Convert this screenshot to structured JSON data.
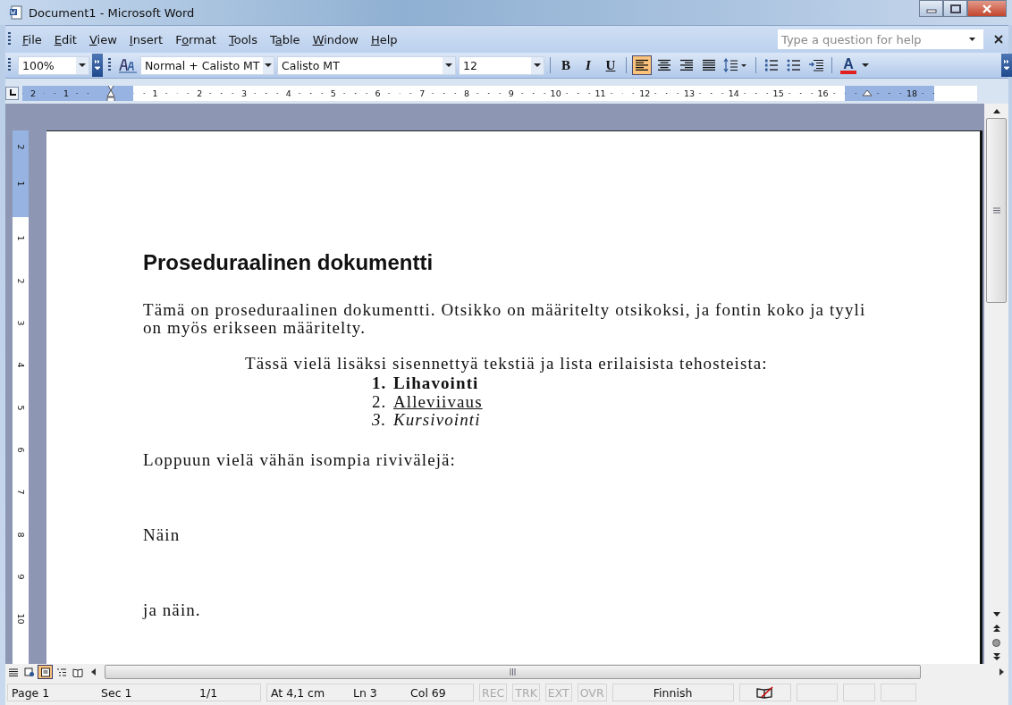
{
  "window": {
    "title": "Document1 - Microsoft Word"
  },
  "menu": [
    {
      "label": "File"
    },
    {
      "label": "Edit"
    },
    {
      "label": "View"
    },
    {
      "label": "Insert"
    },
    {
      "label": "Format"
    },
    {
      "label": "Tools"
    },
    {
      "label": "Table"
    },
    {
      "label": "Window"
    },
    {
      "label": "Help"
    }
  ],
  "help_box": {
    "placeholder": "Type a question for help"
  },
  "toolbar": [
    {
      "kind": "zoom",
      "value": "100%"
    },
    {
      "kind": "style",
      "value": "Normal + Calisto MT"
    },
    {
      "kind": "font",
      "value": "Calisto MT"
    },
    {
      "kind": "size",
      "value": "12"
    },
    {
      "kind": "bold",
      "label": "B",
      "selected": false
    },
    {
      "kind": "italic",
      "label": "I",
      "selected": false
    },
    {
      "kind": "underline",
      "label": "U",
      "selected": false
    },
    {
      "kind": "align-left",
      "selected": true
    },
    {
      "kind": "align-center",
      "selected": false
    },
    {
      "kind": "align-right",
      "selected": false
    },
    {
      "kind": "justify",
      "selected": false
    },
    {
      "kind": "line-spacing"
    },
    {
      "kind": "numbering"
    },
    {
      "kind": "bullets"
    },
    {
      "kind": "indent"
    },
    {
      "kind": "font-color",
      "label": "A"
    }
  ],
  "ruler": {
    "horizontal_before": [
      "2",
      "1"
    ],
    "horizontal_after": [
      "1",
      "2",
      "3",
      "4",
      "5",
      "6",
      "7",
      "8",
      "9",
      "10",
      "11",
      "12",
      "13",
      "14",
      "15",
      "16"
    ],
    "horizontal_end": [
      "18"
    ],
    "vertical_before": [
      "2",
      "1"
    ],
    "vertical_after": [
      "1",
      "2",
      "3",
      "4",
      "5",
      "6",
      "7",
      "8",
      "9",
      "10"
    ]
  },
  "document": [
    {
      "kind": "heading",
      "text": "Proseduraalinen dokumentti"
    },
    {
      "kind": "body",
      "text": "Tämä on proseduraalinen dokumentti. Otsikko on määritelty otsikoksi, ja fontin koko ja tyyli on myös erikseen määritelty."
    },
    {
      "kind": "indented",
      "text": "Tässä vielä lisäksi sisennettyä tekstiä ja lista erilaisista tehosteista:"
    },
    {
      "kind": "list",
      "items": [
        {
          "number": "1.",
          "text": "Lihavointi",
          "kind": "bold"
        },
        {
          "number": "2.",
          "text": "Alleviivaus",
          "kind": "underline"
        },
        {
          "number": "3.",
          "text": "Kursivointi",
          "kind": "italic"
        }
      ]
    },
    {
      "kind": "body",
      "text": "Loppuun vielä vähän isompia rivivälejä:"
    },
    {
      "kind": "wide",
      "text": "Näin"
    },
    {
      "kind": "wide",
      "text": "ja näin."
    }
  ],
  "view_buttons": [
    {
      "kind": "normal",
      "selected": false
    },
    {
      "kind": "web",
      "selected": false
    },
    {
      "kind": "print",
      "selected": true
    },
    {
      "kind": "outline",
      "selected": false
    },
    {
      "kind": "reading",
      "selected": false
    }
  ],
  "status_bar": {
    "groups": [
      [
        "Page 1",
        "Sec 1",
        "1/1"
      ],
      [
        "At 4,1 cm",
        "Ln 3",
        "Col 69"
      ]
    ],
    "modes": [
      {
        "label": "REC",
        "on": false
      },
      {
        "label": "TRK",
        "on": false
      },
      {
        "label": "EXT",
        "on": false
      },
      {
        "label": "OVR",
        "on": false
      }
    ],
    "language": "Finnish"
  }
}
